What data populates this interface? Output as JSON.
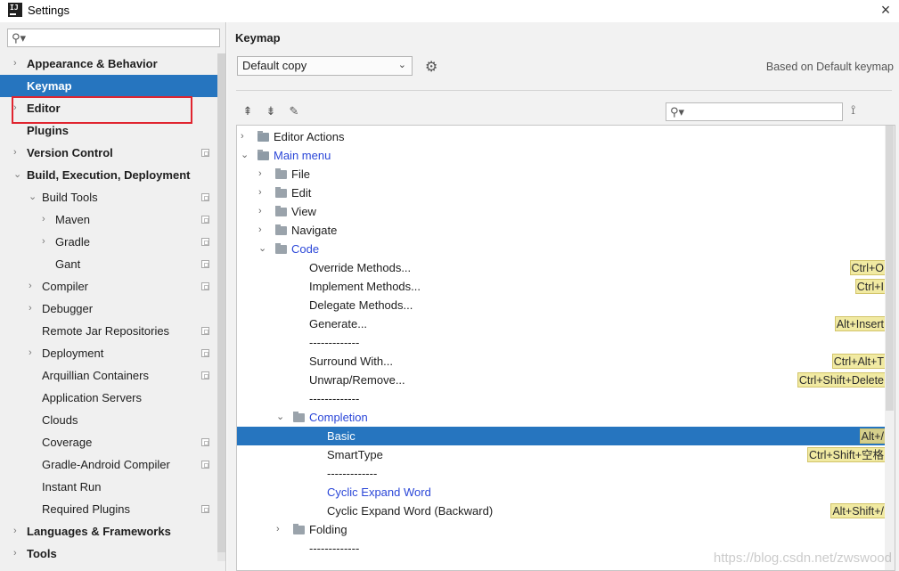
{
  "window": {
    "title": "Settings",
    "close": "×"
  },
  "sidebar": {
    "items": [
      {
        "label": "Appearance & Behavior",
        "bold": true,
        "arrow": "›",
        "indent": 0,
        "proj": false
      },
      {
        "label": "Keymap",
        "bold": true,
        "arrow": "",
        "indent": 0,
        "proj": false,
        "selected": true
      },
      {
        "label": "Editor",
        "bold": true,
        "arrow": "›",
        "indent": 0,
        "proj": false
      },
      {
        "label": "Plugins",
        "bold": true,
        "arrow": "",
        "indent": 0,
        "proj": false
      },
      {
        "label": "Version Control",
        "bold": true,
        "arrow": "›",
        "indent": 0,
        "proj": true
      },
      {
        "label": "Build, Execution, Deployment",
        "bold": true,
        "arrow": "⌄",
        "indent": 0,
        "proj": false
      },
      {
        "label": "Build Tools",
        "bold": false,
        "arrow": "⌄",
        "indent": 1,
        "proj": true
      },
      {
        "label": "Maven",
        "bold": false,
        "arrow": "›",
        "indent": 2,
        "proj": true
      },
      {
        "label": "Gradle",
        "bold": false,
        "arrow": "›",
        "indent": 2,
        "proj": true
      },
      {
        "label": "Gant",
        "bold": false,
        "arrow": "",
        "indent": 2,
        "proj": true
      },
      {
        "label": "Compiler",
        "bold": false,
        "arrow": "›",
        "indent": 1,
        "proj": true
      },
      {
        "label": "Debugger",
        "bold": false,
        "arrow": "›",
        "indent": 1,
        "proj": false
      },
      {
        "label": "Remote Jar Repositories",
        "bold": false,
        "arrow": "",
        "indent": 1,
        "proj": true
      },
      {
        "label": "Deployment",
        "bold": false,
        "arrow": "›",
        "indent": 1,
        "proj": true
      },
      {
        "label": "Arquillian Containers",
        "bold": false,
        "arrow": "",
        "indent": 1,
        "proj": true
      },
      {
        "label": "Application Servers",
        "bold": false,
        "arrow": "",
        "indent": 1,
        "proj": false
      },
      {
        "label": "Clouds",
        "bold": false,
        "arrow": "",
        "indent": 1,
        "proj": false
      },
      {
        "label": "Coverage",
        "bold": false,
        "arrow": "",
        "indent": 1,
        "proj": true
      },
      {
        "label": "Gradle-Android Compiler",
        "bold": false,
        "arrow": "",
        "indent": 1,
        "proj": true
      },
      {
        "label": "Instant Run",
        "bold": false,
        "arrow": "",
        "indent": 1,
        "proj": false
      },
      {
        "label": "Required Plugins",
        "bold": false,
        "arrow": "",
        "indent": 1,
        "proj": true
      },
      {
        "label": "Languages & Frameworks",
        "bold": true,
        "arrow": "›",
        "indent": 0,
        "proj": false
      },
      {
        "label": "Tools",
        "bold": true,
        "arrow": "›",
        "indent": 0,
        "proj": false
      }
    ]
  },
  "main": {
    "title": "Keymap",
    "keymap_select": "Default copy",
    "based_on": "Based on Default keymap",
    "tree": [
      {
        "label": "Editor Actions",
        "arrow": "›",
        "level": 0,
        "icon": "special",
        "link": false,
        "shortcut": ""
      },
      {
        "label": "Main menu",
        "arrow": "⌄",
        "level": 0,
        "icon": "special",
        "link": true,
        "shortcut": ""
      },
      {
        "label": "File",
        "arrow": "›",
        "level": 1,
        "icon": "folder",
        "link": false,
        "shortcut": ""
      },
      {
        "label": "Edit",
        "arrow": "›",
        "level": 1,
        "icon": "folder",
        "link": false,
        "shortcut": ""
      },
      {
        "label": "View",
        "arrow": "›",
        "level": 1,
        "icon": "folder",
        "link": false,
        "shortcut": ""
      },
      {
        "label": "Navigate",
        "arrow": "›",
        "level": 1,
        "icon": "folder",
        "link": false,
        "shortcut": ""
      },
      {
        "label": "Code",
        "arrow": "⌄",
        "level": 1,
        "icon": "folder",
        "link": true,
        "shortcut": ""
      },
      {
        "label": "Override Methods...",
        "arrow": "",
        "level": 2,
        "icon": "",
        "link": false,
        "shortcut": "Ctrl+O"
      },
      {
        "label": "Implement Methods...",
        "arrow": "",
        "level": 2,
        "icon": "",
        "link": false,
        "shortcut": "Ctrl+I"
      },
      {
        "label": "Delegate Methods...",
        "arrow": "",
        "level": 2,
        "icon": "",
        "link": false,
        "shortcut": ""
      },
      {
        "label": "Generate...",
        "arrow": "",
        "level": 2,
        "icon": "",
        "link": false,
        "shortcut": "Alt+Insert"
      },
      {
        "label": "-------------",
        "arrow": "",
        "level": 2,
        "icon": "",
        "link": false,
        "shortcut": ""
      },
      {
        "label": "Surround With...",
        "arrow": "",
        "level": 2,
        "icon": "",
        "link": false,
        "shortcut": "Ctrl+Alt+T"
      },
      {
        "label": "Unwrap/Remove...",
        "arrow": "",
        "level": 2,
        "icon": "",
        "link": false,
        "shortcut": "Ctrl+Shift+Delete"
      },
      {
        "label": "-------------",
        "arrow": "",
        "level": 2,
        "icon": "",
        "link": false,
        "shortcut": ""
      },
      {
        "label": "Completion",
        "arrow": "⌄",
        "level": 2,
        "icon": "folder",
        "link": true,
        "shortcut": ""
      },
      {
        "label": "Basic",
        "arrow": "",
        "level": 3,
        "icon": "",
        "link": false,
        "shortcut": "Alt+/",
        "selected": true
      },
      {
        "label": "SmartType",
        "arrow": "",
        "level": 3,
        "icon": "",
        "link": false,
        "shortcut": "Ctrl+Shift+空格"
      },
      {
        "label": "-------------",
        "arrow": "",
        "level": 3,
        "icon": "",
        "link": false,
        "shortcut": ""
      },
      {
        "label": "Cyclic Expand Word",
        "arrow": "",
        "level": 3,
        "icon": "",
        "link": true,
        "shortcut": ""
      },
      {
        "label": "Cyclic Expand Word (Backward)",
        "arrow": "",
        "level": 3,
        "icon": "",
        "link": false,
        "shortcut": "Alt+Shift+/"
      },
      {
        "label": "Folding",
        "arrow": "›",
        "level": 2,
        "icon": "folder",
        "link": false,
        "shortcut": ""
      },
      {
        "label": "-------------",
        "arrow": "",
        "level": 2,
        "icon": "",
        "link": false,
        "shortcut": ""
      }
    ]
  },
  "watermark": "https://blog.csdn.net/zwswood",
  "colors": {
    "selection": "#2675bf",
    "shortcut_bg": "#f1eaa2",
    "link": "#2b47d8",
    "highlight_border": "#e0242f"
  }
}
